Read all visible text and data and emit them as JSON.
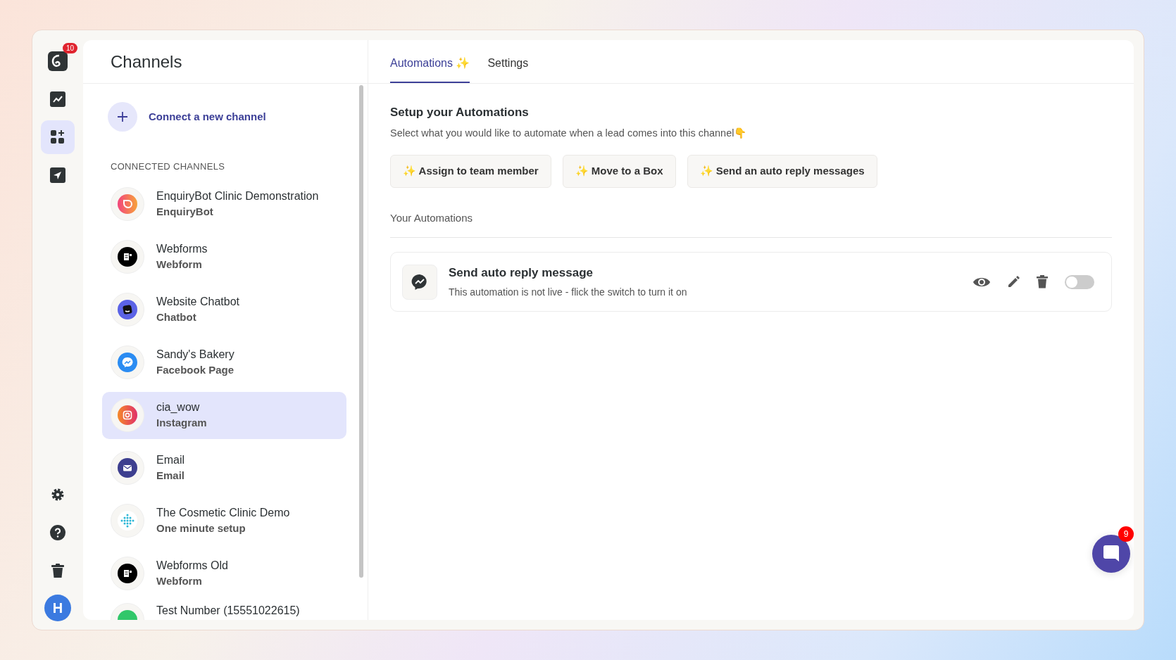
{
  "rail": {
    "logo_badge": "10",
    "items": [
      {
        "kind": "chart",
        "selected": false
      },
      {
        "kind": "apps",
        "selected": true
      },
      {
        "kind": "send",
        "selected": false
      }
    ],
    "bottom": [
      {
        "kind": "settings"
      },
      {
        "kind": "help"
      },
      {
        "kind": "trash"
      }
    ],
    "avatar": "H"
  },
  "channels": {
    "title": "Channels",
    "connect": "Connect a new channel",
    "section": "CONNECTED CHANNELS",
    "items": [
      {
        "name": "EnquiryBot Clinic Demonstration",
        "type": "EnquiryBot",
        "kind": "enquirybot",
        "selected": false
      },
      {
        "name": "Webforms",
        "type": "Webform",
        "kind": "webform",
        "selected": false
      },
      {
        "name": "Website Chatbot",
        "type": "Chatbot",
        "kind": "chatbot",
        "selected": false
      },
      {
        "name": "Sandy's Bakery",
        "type": "Facebook Page",
        "kind": "messenger",
        "selected": false
      },
      {
        "name": "cia_wow",
        "type": "Instagram",
        "kind": "instagram",
        "selected": true
      },
      {
        "name": "Email",
        "type": "Email",
        "kind": "email",
        "selected": false
      },
      {
        "name": "The Cosmetic Clinic Demo",
        "type": "One minute setup",
        "kind": "dots",
        "selected": false
      },
      {
        "name": "Webforms Old",
        "type": "Webform",
        "kind": "webform",
        "selected": false
      },
      {
        "name": "Test Number (15551022615)",
        "kind": "phone",
        "selected": false
      }
    ]
  },
  "tabs": [
    {
      "label": "Automations ✨",
      "selected": true
    },
    {
      "label": "Settings",
      "selected": false
    }
  ],
  "setup": {
    "title": "Setup your Automations",
    "subtitle": "Select what you would like to automate when a lead comes into this channel👇",
    "actions": [
      "✨ Assign to team member",
      "✨ Move to a Box",
      "✨ Send an auto reply messages"
    ]
  },
  "your_automations": {
    "title": "Your Automations",
    "items": [
      {
        "name": "Send auto reply message",
        "description": "This automation is not live - flick the switch to turn it on",
        "on": false
      }
    ]
  },
  "chat_widget": {
    "badge": "9"
  }
}
